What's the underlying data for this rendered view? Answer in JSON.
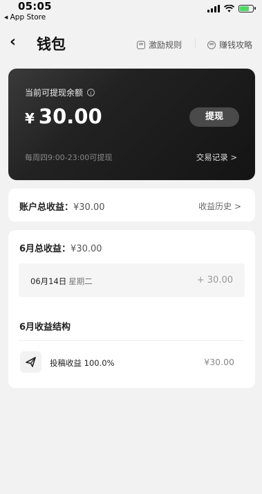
{
  "status": {
    "time": "05:05",
    "back_app": "◂ App Store"
  },
  "nav": {
    "back_symbol": "‹",
    "title": "钱包",
    "rules_link": "激励规则",
    "guide_link": "赚钱攻略"
  },
  "wallet": {
    "label": "当前可提现余额",
    "info_symbol": "i",
    "currency": "¥",
    "amount": "30.00",
    "withdraw_button": "提现",
    "hint": "每周四9:00-23:00可提现",
    "records_link": "交易记录 >"
  },
  "total": {
    "label": "账户总收益：",
    "value": "¥30.00",
    "history_link": "收益历史 >"
  },
  "month": {
    "title_label": "6月总收益：",
    "title_value": "¥30.00",
    "day": {
      "date": "06月14日",
      "weekday": "星期二",
      "amount": "+ 30.00"
    },
    "structure_title": "6月收益结构",
    "structure_item": {
      "label": "投稿收益 100.0%",
      "amount": "¥30.00",
      "icon": "paper-plane-icon"
    }
  },
  "colors": {
    "card_dark": "#1e1e1e",
    "battery_green": "#4cd964",
    "background": "#f2f2f2"
  }
}
